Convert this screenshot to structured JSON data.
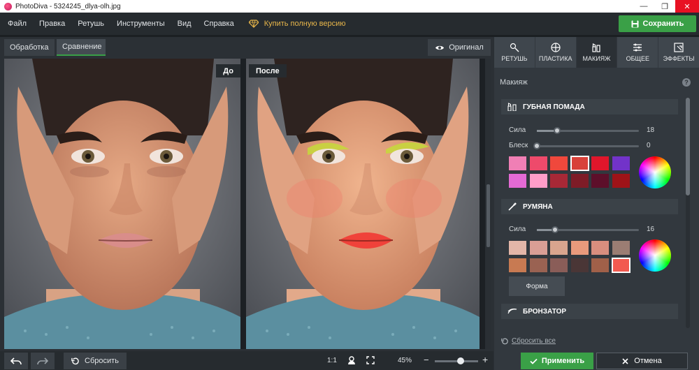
{
  "window": {
    "title": "PhotoDiva - 5324245_dlya-olh.jpg",
    "minimize": "—",
    "maximize": "❐",
    "close": "✕"
  },
  "menu": {
    "items": [
      "Файл",
      "Правка",
      "Ретушь",
      "Инструменты",
      "Вид",
      "Справка"
    ],
    "buy_full": "Купить полную версию"
  },
  "save_label": "Сохранить",
  "compare_tabs": [
    "Обработка",
    "Сравнение"
  ],
  "original_label": "Оригинал",
  "labels": {
    "before": "До",
    "after": "После"
  },
  "bottom": {
    "reset": "Сбросить",
    "ratio": "1:1",
    "zoom": "45%",
    "minus": "−",
    "plus": "+"
  },
  "panel": {
    "tabs": [
      "РЕТУШЬ",
      "ПЛАСТИКА",
      "МАКИЯЖ",
      "ОБЩЕЕ",
      "ЭФФЕКТЫ"
    ],
    "active_tab": "МАКИЯЖ",
    "section_title": "Макияж",
    "help": "?",
    "lipstick": {
      "title": "ГУБНАЯ ПОМАДА",
      "strength_label": "Сила",
      "strength_value": "18",
      "strength_level": 0.2,
      "gloss_label": "Блеск",
      "gloss_value": "0",
      "gloss_level": 0.0,
      "swatches": [
        "#f07fb5",
        "#ee4a6b",
        "#f0483c",
        "#d8413a",
        "#e0162b",
        "#7233c9",
        "#e46ad4",
        "#ff9dc8",
        "#a82836",
        "#7e1c27",
        "#5d0f2a",
        "#9e1318"
      ],
      "selected_swatch": 3
    },
    "blush": {
      "title": "РУМЯНА",
      "strength_label": "Сила",
      "strength_value": "16",
      "strength_level": 0.18,
      "swatches": [
        "#e3b6a8",
        "#d99e95",
        "#d9a58e",
        "#e99a7c",
        "#d98e7e",
        "#9b7d73",
        "#c87a52",
        "#9a6252",
        "#8a5d58",
        "#4a3636",
        "#a06049",
        "#f25a50"
      ],
      "selected_swatch": 11,
      "shape_button": "Форма"
    },
    "bronzer": {
      "title": "БРОНЗАТОР"
    },
    "reset_all": "Сбросить все",
    "apply": "Применить",
    "cancel": "Отмена"
  }
}
